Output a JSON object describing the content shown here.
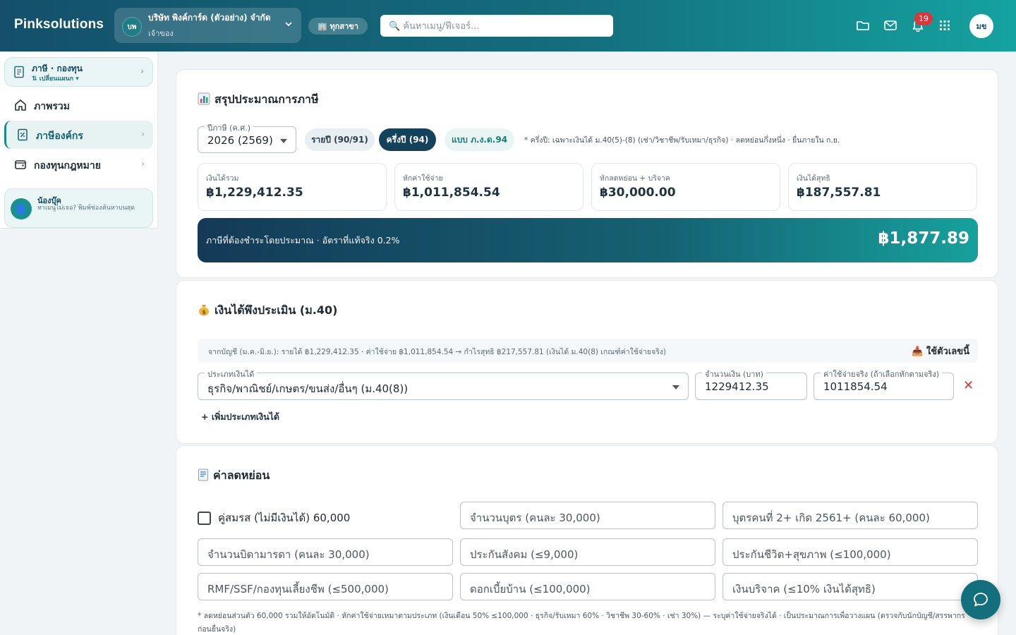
{
  "header": {
    "brand": "Pinksolutions",
    "company": {
      "avatar": "บพ",
      "name": "บริษัท พิงค์การ์ด (ตัวอย่าง) จำกัด",
      "role": "เจ้าของ"
    },
    "branch": "🏢 ทุกสาขา",
    "search_placeholder": "🔍 ค้นหาเมนู/ฟีเจอร์...",
    "notification_count": "19",
    "user_initials": "มข",
    "icons": [
      "folder-icon",
      "mail-icon",
      "bell-icon",
      "apps-grid-icon"
    ]
  },
  "sidebar": {
    "module": {
      "title": "ภาษี · กองทุน",
      "switch": "⇅ เปลี่ยนแผนก ▾"
    },
    "items": [
      {
        "label": "ภาพรวม",
        "icon": "home-icon"
      },
      {
        "label": "ภาษีองค์กร",
        "icon": "tax-doc-icon",
        "active": true
      },
      {
        "label": "กองทุนกฎหมาย",
        "icon": "wallet-icon"
      }
    ],
    "help": {
      "title": "น้องบุ๊ค",
      "text": "หาเมนูไม่เจอ? พิมพ์ช่องค้นหาบนสุด"
    }
  },
  "summary": {
    "title": "สรุปประมาณการภาษี",
    "year_label": "ปีภาษี (ค.ศ.)",
    "year_value": "2026 (2569)",
    "chips": {
      "yearly": "รายปี (90/91)",
      "half": "ครึ่งปี (94)",
      "form": "แบบ ภ.ง.ด.94"
    },
    "note": "* ครึ่งปี: เฉพาะเงินได้ ม.40(5)-(8) (เช่า/วิชาชีพ/รับเหมา/ธุรกิจ) · ลดหย่อนกึ่งหนึ่ง · ยื่นภายใน ก.ย.",
    "stats": [
      {
        "label": "เงินได้รวม",
        "value": "฿1,229,412.35"
      },
      {
        "label": "หักค่าใช้จ่าย",
        "value": "฿1,011,854.54"
      },
      {
        "label": "หักลดหย่อน + บริจาค",
        "value": "฿30,000.00"
      },
      {
        "label": "เงินได้สุทธิ",
        "value": "฿187,557.81"
      }
    ],
    "tax_label": "ภาษีที่ต้องชำระโดยประมาณ · อัตราที่แท้จริง 0.2%",
    "tax_value": "฿1,877.89"
  },
  "income": {
    "title": "เงินได้พึงประเมิน (ม.40)",
    "hint": "จากบัญชี (ม.ค.-มิ.ย.): รายได้ ฿1,229,412.35 · ค่าใช้จ่าย ฿1,011,854.54 → กำไรสุทธิ ฿217,557.81 (เงินได้ ม.40(8) เกณฑ์ค่าใช้จ่ายจริง)",
    "use_button": "📥 ใช้ตัวเลขนี้",
    "type_label": "ประเภทเงินได้",
    "type_value": "ธุรกิจ/พาณิชย์/เกษตร/ขนส่ง/อื่นๆ (ม.40(8))",
    "amount_label": "จำนวนเงิน (บาท)",
    "amount_value": "1229412.35",
    "expense_label": "ค่าใช้จ่ายจริง (ถ้าเลือกหักตามจริง)",
    "expense_value": "1011854.54",
    "delete": "✕",
    "add": "+ เพิ่มประเภทเงินได้"
  },
  "deductions": {
    "title": "ค่าลดหย่อน",
    "spouse": "คู่สมรส (ไม่มีเงินได้) 60,000",
    "fields": [
      "จำนวนบุตร (คนละ 30,000)",
      "บุตรคนที่ 2+ เกิด 2561+ (คนละ 60,000)",
      "จำนวนบิดามารดา (คนละ 30,000)",
      "ประกันสังคม (≤9,000)",
      "ประกันชีวิต+สุขภาพ (≤100,000)",
      "RMF/SSF/กองทุนเลี้ยงชีพ (≤500,000)",
      "ดอกเบี้ยบ้าน (≤100,000)",
      "เงินบริจาค (≤10% เงินได้สุทธิ)"
    ],
    "note": "* ลดหย่อนส่วนตัว 60,000 รวมให้อัตโนมัติ · หักค่าใช้จ่ายเหมาตามประเภท (เงินเดือน 50% ≤100,000 · ธุรกิจ/รับเหมา 60% · วิชาชีพ 30-60% · เช่า 30%) — ระบุค่าใช้จ่ายจริงได้ · เป็นประมาณการเพื่อวางแผน (ตรวจกับนักบัญชี/สรรพากรก่อนยื่นจริง)"
  }
}
